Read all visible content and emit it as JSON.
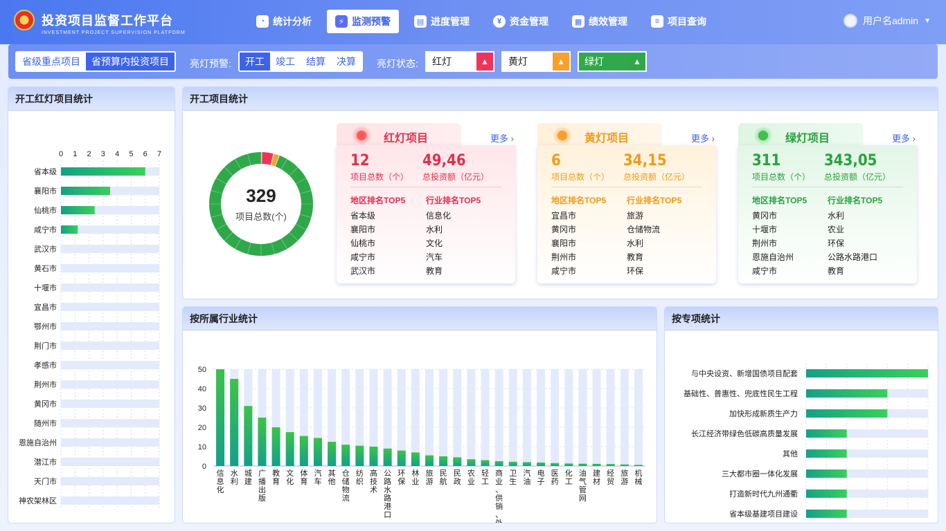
{
  "header": {
    "title": "投资项目监督工作平台",
    "subtitle": "INVESTMENT PROJECT SUPERVISION PLATFORM",
    "nav": [
      {
        "label": "统计分析",
        "icon": "pie-chart-icon"
      },
      {
        "label": "监测预警",
        "icon": "alarm-icon"
      },
      {
        "label": "进度管理",
        "icon": "progress-icon"
      },
      {
        "label": "资金管理",
        "icon": "yuan-icon"
      },
      {
        "label": "绩效管理",
        "icon": "performance-icon"
      },
      {
        "label": "项目查询",
        "icon": "document-icon"
      }
    ],
    "user": "用户名admin"
  },
  "filters": {
    "scope": [
      "省级重点项目",
      "省预算内投资项目"
    ],
    "warning_label": "亮灯预警:",
    "stages": [
      "开工",
      "竣工",
      "结算",
      "决算"
    ],
    "status_label": "亮灯状态:",
    "lights": [
      "红灯",
      "黄灯",
      "绿灯"
    ]
  },
  "left_panel": {
    "title": "开工红灯项目统计",
    "chart_data": {
      "type": "bar",
      "orientation": "horizontal",
      "categories": [
        "省本级",
        "襄阳市",
        "仙桃市",
        "咸宁市",
        "武汉市",
        "黄石市",
        "十堰市",
        "宜昌市",
        "鄂州市",
        "荆门市",
        "孝感市",
        "荆州市",
        "黄冈市",
        "随州市",
        "恩施自治州",
        "潜江市",
        "天门市",
        "神农架林区"
      ],
      "values": [
        6,
        3.5,
        2.4,
        1.2,
        0,
        0,
        0,
        0,
        0,
        0,
        0,
        0,
        0,
        0,
        0,
        0,
        0,
        0
      ],
      "xticks": [
        "0",
        "1",
        "2",
        "3",
        "4",
        "5",
        "6",
        "7"
      ],
      "xlim": [
        0,
        7
      ]
    }
  },
  "overview": {
    "title": "开工项目统计",
    "total": "329",
    "total_label": "项目总数(个)",
    "donut": [
      {
        "name": "红灯",
        "value": 12,
        "color": "#f0335a"
      },
      {
        "name": "黄灯",
        "value": 6,
        "color": "#f7a12b"
      },
      {
        "name": "绿灯",
        "value": 311,
        "color": "#2fa84a"
      }
    ],
    "more": "更多",
    "cards": [
      {
        "title": "红灯项目",
        "count": "12",
        "count_label": "项目总数（个）",
        "amount": "49,46",
        "amount_label": "总投资额（亿元）",
        "region_head": "地区排名TOP5",
        "industry_head": "行业排名TOP5",
        "regions": [
          "省本级",
          "襄阳市",
          "仙桃市",
          "咸宁市",
          "武汉市"
        ],
        "industries": [
          "信息化",
          "水利",
          "文化",
          "汽车",
          "教育"
        ]
      },
      {
        "title": "黄灯项目",
        "count": "6",
        "count_label": "项目总数（个）",
        "amount": "34,15",
        "amount_label": "总投资额（亿元）",
        "region_head": "地区排名TOP5",
        "industry_head": "行业排名TOP5",
        "regions": [
          "宜昌市",
          "黄冈市",
          "襄阳市",
          "荆州市",
          "咸宁市"
        ],
        "industries": [
          "旅游",
          "仓储物流",
          "水利",
          "教育",
          "环保"
        ]
      },
      {
        "title": "绿灯项目",
        "count": "311",
        "count_label": "项目总数（个）",
        "amount": "343,05",
        "amount_label": "总投资额（亿元）",
        "region_head": "地区排名TOP5",
        "industry_head": "行业排名TOP5",
        "regions": [
          "黄冈市",
          "十堰市",
          "荆州市",
          "恩施自治州",
          "咸宁市"
        ],
        "industries": [
          "水利",
          "农业",
          "环保",
          "公路水路港口",
          "教育"
        ]
      }
    ]
  },
  "industry_panel": {
    "title": "按所属行业统计",
    "chart_data": {
      "type": "bar",
      "categories": [
        "信息化",
        "水利",
        "城建",
        "广播出版",
        "教育",
        "文化",
        "体育",
        "汽车",
        "其他",
        "仓储物流",
        "纺织",
        "高技术",
        "公路水路港口",
        "环保",
        "林业",
        "旅游",
        "民航",
        "民政",
        "农业",
        "轻工",
        "商业、供销、外贸",
        "卫生",
        "汽油",
        "电子",
        "医药",
        "化工",
        "油气管网",
        "建材",
        "经贸",
        "旅游",
        "机械"
      ],
      "values": [
        50,
        45,
        31,
        25,
        20,
        17.5,
        15.5,
        14.5,
        12.5,
        11,
        10.5,
        10,
        9,
        8,
        7,
        5.5,
        5,
        4.5,
        3.5,
        3,
        2.5,
        2.2,
        2,
        1.8,
        1.5,
        1.3,
        1.2,
        1.1,
        1,
        0.8,
        0.6
      ],
      "yticks": [
        "0",
        "10",
        "20",
        "30",
        "40",
        "50"
      ],
      "ylim": [
        0,
        50
      ]
    }
  },
  "special_panel": {
    "title": "按专项统计",
    "chart_data": {
      "type": "bar",
      "orientation": "horizontal",
      "categories": [
        "与中央设资、新增国债项目配套",
        "基础性、普惠性、兜底性民生工程",
        "加快形成新质生产力",
        "长江经济带绿色低碳高质量发展",
        "其他",
        "三大都市圈一体化发展",
        "打造新时代九州通衢",
        "省本级基建项目建设"
      ],
      "values": [
        3,
        2,
        2,
        1,
        1,
        1,
        1,
        1
      ],
      "xticks": [
        "0",
        "0.5",
        "1",
        "1.5",
        "2",
        "2.5",
        "3"
      ],
      "xlim": [
        0,
        3
      ]
    }
  }
}
